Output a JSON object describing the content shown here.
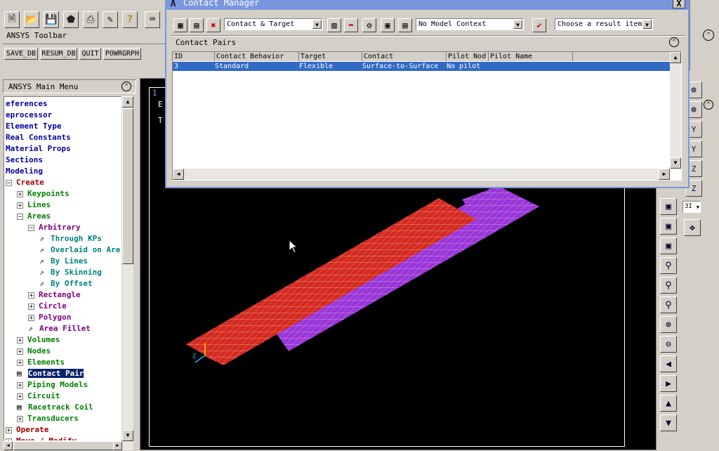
{
  "toolbar": {
    "icons": [
      "new-file-icon",
      "open-folder-icon",
      "save-icon",
      "cube-icon",
      "print-icon",
      "edit-icon",
      "help-icon",
      "keyboard-icon"
    ]
  },
  "ansys_toolbar": {
    "title": "ANSYS Toolbar",
    "buttons": [
      "SAVE_DB",
      "RESUM_DB",
      "QUIT",
      "POWRGRPH"
    ]
  },
  "main_menu": {
    "title": "ANSYS Main Menu",
    "items": [
      {
        "label": "eferences",
        "indent": 0,
        "kind": "none",
        "color": "blue"
      },
      {
        "label": "eprocessor",
        "indent": 0,
        "kind": "none",
        "color": "blue"
      },
      {
        "label": "Element Type",
        "indent": 0,
        "kind": "none",
        "color": "blue"
      },
      {
        "label": "Real Constants",
        "indent": 0,
        "kind": "none",
        "color": "blue"
      },
      {
        "label": "Material Props",
        "indent": 0,
        "kind": "none",
        "color": "blue"
      },
      {
        "label": "Sections",
        "indent": 0,
        "kind": "none",
        "color": "blue"
      },
      {
        "label": "Modeling",
        "indent": 0,
        "kind": "none",
        "color": "blue"
      },
      {
        "label": "Create",
        "indent": 0,
        "kind": "minus",
        "color": "red"
      },
      {
        "label": "Keypoints",
        "indent": 1,
        "kind": "plus",
        "color": "green"
      },
      {
        "label": "Lines",
        "indent": 1,
        "kind": "plus",
        "color": "green"
      },
      {
        "label": "Areas",
        "indent": 1,
        "kind": "minus",
        "color": "green"
      },
      {
        "label": "Arbitrary",
        "indent": 2,
        "kind": "minus",
        "color": "purple"
      },
      {
        "label": "Through KPs",
        "indent": 3,
        "kind": "leaf",
        "color": "teal"
      },
      {
        "label": "Overlaid on Are",
        "indent": 3,
        "kind": "leaf",
        "color": "teal"
      },
      {
        "label": "By Lines",
        "indent": 3,
        "kind": "leaf",
        "color": "teal"
      },
      {
        "label": "By Skinning",
        "indent": 3,
        "kind": "leaf",
        "color": "teal"
      },
      {
        "label": "By Offset",
        "indent": 3,
        "kind": "leaf",
        "color": "teal"
      },
      {
        "label": "Rectangle",
        "indent": 2,
        "kind": "plus",
        "color": "purple"
      },
      {
        "label": "Circle",
        "indent": 2,
        "kind": "plus",
        "color": "purple"
      },
      {
        "label": "Polygon",
        "indent": 2,
        "kind": "plus",
        "color": "purple"
      },
      {
        "label": "Area Fillet",
        "indent": 2,
        "kind": "leaf",
        "color": "purple"
      },
      {
        "label": "Volumes",
        "indent": 1,
        "kind": "plus",
        "color": "green"
      },
      {
        "label": "Nodes",
        "indent": 1,
        "kind": "plus",
        "color": "green"
      },
      {
        "label": "Elements",
        "indent": 1,
        "kind": "plus",
        "color": "green"
      },
      {
        "label": "Contact Pair",
        "indent": 1,
        "kind": "table",
        "color": "selected"
      },
      {
        "label": "Piping Models",
        "indent": 1,
        "kind": "plus",
        "color": "green"
      },
      {
        "label": "Circuit",
        "indent": 1,
        "kind": "plus",
        "color": "green"
      },
      {
        "label": "Racetrack Coil",
        "indent": 1,
        "kind": "table",
        "color": "green"
      },
      {
        "label": "Transducers",
        "indent": 1,
        "kind": "plus",
        "color": "green"
      },
      {
        "label": "Operate",
        "indent": 0,
        "kind": "plus",
        "color": "red"
      },
      {
        "label": "Move / Modify",
        "indent": 0,
        "kind": "plus",
        "color": "red"
      }
    ]
  },
  "graphics": {
    "window_number": "1",
    "text_line1": "E",
    "text_line2": "T",
    "triad_z": "Z"
  },
  "contact_manager": {
    "title": "Contact Manager",
    "close_glyph": "X",
    "type_combo": "Contact & Target",
    "context_combo": "No Model Context",
    "result_combo": "Choose a result item",
    "section_title": "Contact Pairs",
    "columns": [
      "ID",
      "Contact Behavior",
      "Target",
      "Contact",
      "Pilot Nod",
      "Pilot Name"
    ],
    "rows": [
      {
        "id": "3",
        "behavior": "Standard",
        "target": "Flexible",
        "contact": "Surface-to-Surface",
        "pilot_node": "No pilot",
        "pilot_name": ""
      }
    ]
  },
  "right_toolbar": {
    "view_combo": "3I",
    "icons": [
      "rotate-x-icon",
      "rotate-xy-icon",
      "rotate-y-icon",
      "y-axis-icon",
      "rotate-z-icon",
      "z-axis-icon",
      "iso-view-icon",
      "oblique-view-icon",
      "front-view-icon",
      "back-view-icon",
      "zoom-icon",
      "zoom-box-icon",
      "zoom-back-icon",
      "zoom-in-icon",
      "zoom-out-icon",
      "pan-left-icon",
      "pan-right-icon",
      "pan-up-icon",
      "pan-down-icon",
      "dynamic-icon"
    ]
  },
  "colors": {
    "selection": "#0a246a",
    "titlebar": "#7a96df",
    "red_mesh": "#d42a1e",
    "purple_mesh": "#9a36d8",
    "graphics_bg": "#000000"
  }
}
